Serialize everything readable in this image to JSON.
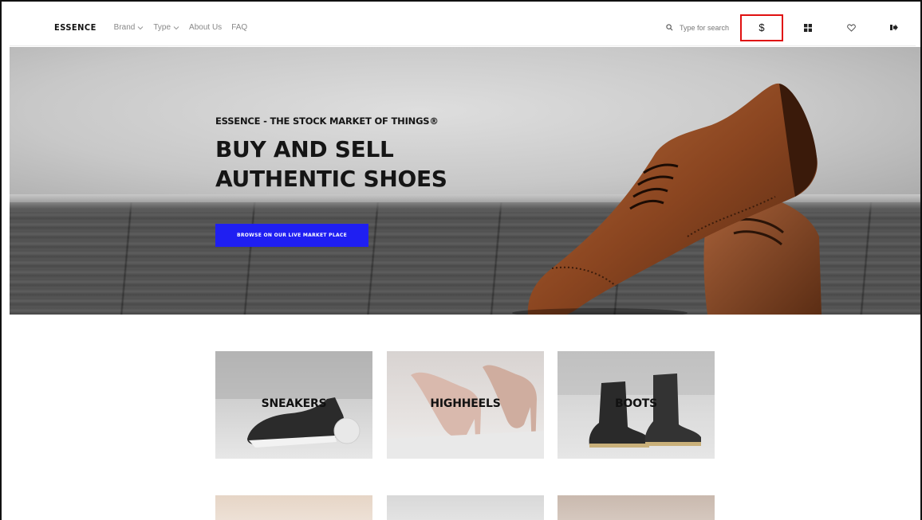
{
  "header": {
    "logo": "ESSENCE",
    "nav": [
      {
        "label": "Brand",
        "has_dropdown": true
      },
      {
        "label": "Type",
        "has_dropdown": true
      },
      {
        "label": "About Us",
        "has_dropdown": false
      },
      {
        "label": "FAQ",
        "has_dropdown": false
      }
    ],
    "search": {
      "placeholder": "Type for search",
      "value": ""
    },
    "currency_symbol": "$",
    "icons": [
      "grid-icon",
      "heart-icon",
      "logout-icon"
    ]
  },
  "hero": {
    "eyebrow": "ESSENCE - THE STOCK MARKET OF THINGS®",
    "headline_line1": "BUY AND SELL",
    "headline_line2": "AUTHENTIC SHOES",
    "cta_label": "BROWSE ON OUR LIVE MARKET PLACE",
    "cta_color": "#1f1ff2"
  },
  "categories": [
    {
      "label": "SNEAKERS"
    },
    {
      "label": "HIGHHEELS"
    },
    {
      "label": "BOOTS"
    }
  ],
  "colors": {
    "highlight_border": "#e01010",
    "text_dark": "#111111",
    "nav_text": "#888888"
  }
}
